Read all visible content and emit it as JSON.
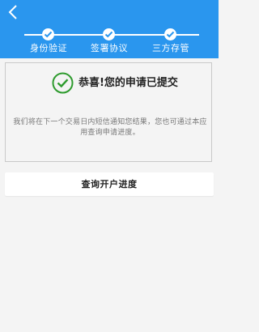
{
  "header": {
    "steps": [
      {
        "label": "身份验证",
        "status": "done"
      },
      {
        "label": "签署协议",
        "status": "done"
      },
      {
        "label": "三方存管",
        "status": "done"
      }
    ]
  },
  "result": {
    "title": "恭喜!您的申请已提交",
    "message": "我们将在下一个交易日内短信通知您结果，您也可通过本应用查询申请进度。"
  },
  "actions": {
    "query_label": "查询开户进度"
  },
  "colors": {
    "header_bg": "#2a96ee",
    "success_green": "#2e9b2e",
    "page_bg": "#f4f4f4"
  },
  "icons": {
    "back": "chevron-left-icon",
    "step_done": "check-icon",
    "success": "check-circle-icon"
  }
}
